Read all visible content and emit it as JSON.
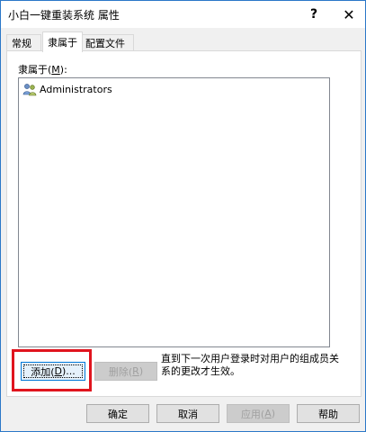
{
  "window": {
    "title": "小白一键重装系统 属性",
    "help_glyph": "?",
    "close_glyph": "✕"
  },
  "tabs": [
    {
      "label": "常规"
    },
    {
      "label": "隶属于"
    },
    {
      "label": "配置文件"
    }
  ],
  "member_of": {
    "label": "隶属于(",
    "accesskey": "M",
    "label_end": "):",
    "items": [
      {
        "name": "Administrators",
        "icon": "group-icon"
      }
    ]
  },
  "actions": {
    "add_label": "添加(",
    "add_key": "D",
    "add_end": ")...",
    "remove_label": "删除(",
    "remove_key": "R",
    "remove_end": ")",
    "note": "直到下一次用户登录时对用户的组成员关系的更改才生效。"
  },
  "footer": {
    "ok": "确定",
    "cancel": "取消",
    "apply_label": "应用(",
    "apply_key": "A",
    "apply_end": ")",
    "help": "帮助"
  },
  "colors": {
    "highlight": "#e0141e",
    "window_border": "#2b78c8",
    "focus_border": "#0078d7"
  }
}
